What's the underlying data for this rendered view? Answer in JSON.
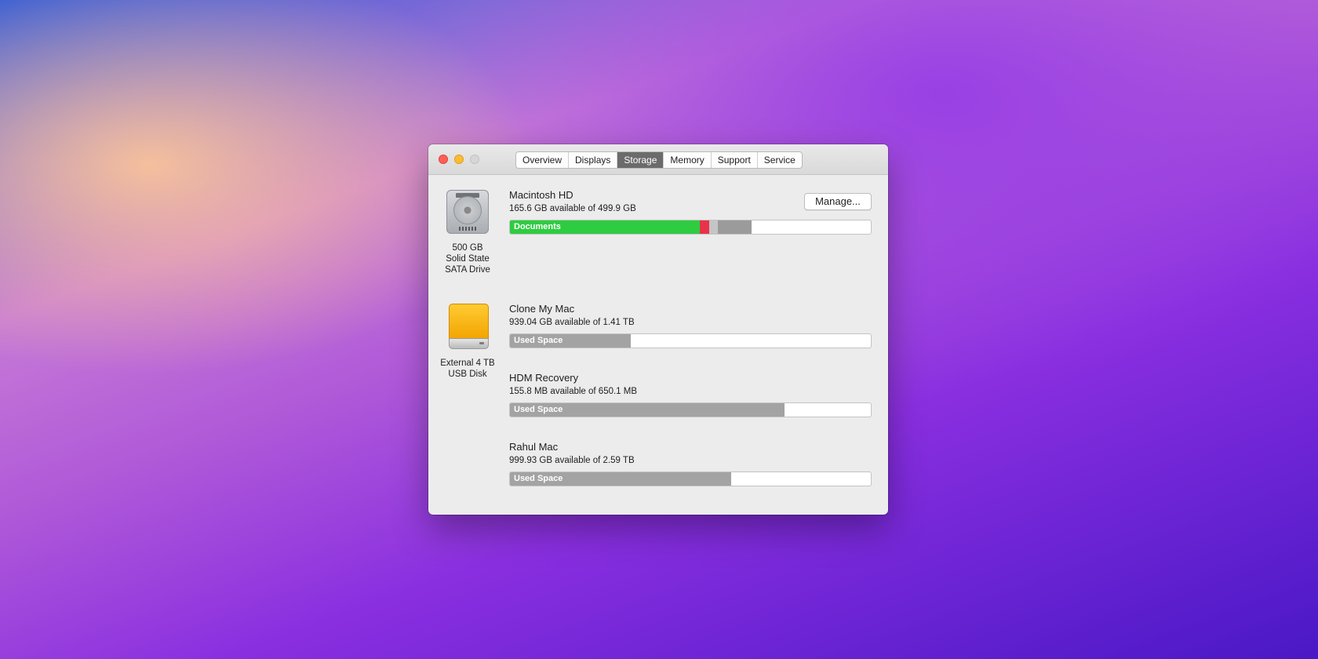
{
  "window": {
    "tabs": [
      {
        "label": "Overview",
        "active": false
      },
      {
        "label": "Displays",
        "active": false
      },
      {
        "label": "Storage",
        "active": true
      },
      {
        "label": "Memory",
        "active": false
      },
      {
        "label": "Support",
        "active": false
      },
      {
        "label": "Service",
        "active": false
      }
    ],
    "traffic_lights": [
      "close",
      "minimize",
      "zoom"
    ]
  },
  "drives": [
    {
      "icon": "hard-drive-icon",
      "caption": [
        "500 GB",
        "Solid State",
        "SATA Drive"
      ]
    },
    {
      "icon": "external-disk-icon",
      "caption": [
        "External 4 TB",
        "USB Disk"
      ]
    }
  ],
  "manage_button": "Manage...",
  "volumes": [
    {
      "name": "Macintosh HD",
      "available": "165.6 GB available of 499.9 GB",
      "usage": [
        {
          "label": "Documents",
          "fraction": 0.525,
          "color": "#2ecc40"
        },
        {
          "label": "",
          "fraction": 0.027,
          "color": "#e8334a"
        },
        {
          "label": "",
          "fraction": 0.025,
          "color": "#c5c5c5"
        },
        {
          "label": "",
          "fraction": 0.093,
          "color": "#9b9b9b"
        }
      ]
    },
    {
      "name": "Clone My Mac",
      "available": "939.04 GB available of 1.41 TB",
      "usage": [
        {
          "label": "Used Space",
          "fraction": 0.334,
          "color": "#a3a3a3"
        }
      ]
    },
    {
      "name": "HDM Recovery",
      "available": "155.8 MB available of 650.1 MB",
      "usage": [
        {
          "label": "Used Space",
          "fraction": 0.76,
          "color": "#a3a3a3"
        }
      ]
    },
    {
      "name": "Rahul Mac",
      "available": "999.93 GB available of 2.59 TB",
      "usage": [
        {
          "label": "Used Space",
          "fraction": 0.613,
          "color": "#a3a3a3"
        }
      ]
    }
  ]
}
